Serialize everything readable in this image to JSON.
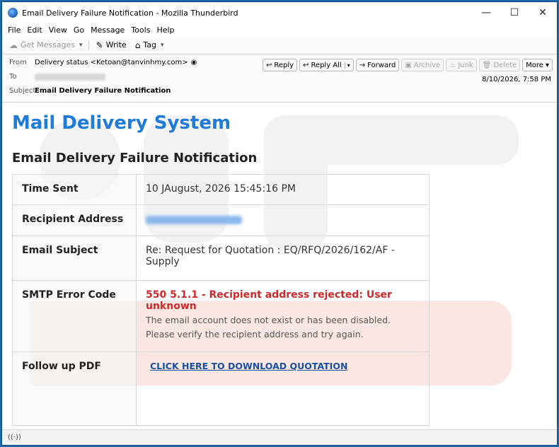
{
  "window": {
    "title": "Email Delivery Failure Notification - Mozilla Thunderbird",
    "controls": {
      "minimize": "—",
      "maximize": "☐",
      "close": "✕"
    }
  },
  "menu": {
    "items": [
      {
        "label": "File"
      },
      {
        "label": "Edit"
      },
      {
        "label": "View"
      },
      {
        "label": "Go"
      },
      {
        "label": "Message"
      },
      {
        "label": "Tools"
      },
      {
        "label": "Help"
      }
    ]
  },
  "toolbar": {
    "get_messages": "Get Messages",
    "write": "Write",
    "tag": "Tag"
  },
  "header": {
    "from_label": "From",
    "from_value": "Delivery status <Ketoan@tanvinhmy.com>",
    "to_label": "To",
    "subject_label": "Subject",
    "subject_value": "Email Delivery Failure Notification",
    "date": "8/10/2026, 7:58 PM",
    "actions": {
      "reply": "Reply",
      "reply_all": "Reply All",
      "forward": "Forward",
      "archive": "Archive",
      "junk": "Junk",
      "delete": "Delete",
      "more": "More"
    }
  },
  "message": {
    "heading": "Mail Delivery System",
    "subheading": "Email Delivery Failure Notification",
    "rows": {
      "time_sent_label": "Time Sent",
      "time_sent_value": "10 JAugust, 2026 15:45:16 PM",
      "recipient_label": "Recipient Address",
      "subject_label": "Email Subject",
      "subject_value": "Re: Request for Quotation : EQ/RFQ/2026/162/AF - Supply",
      "smtp_label": "SMTP Error Code",
      "smtp_code": "550 5.1.1 - Recipient address rejected: User unknown",
      "smtp_desc": "The email account does not exist or has been disabled. Please verify the recipient address and try again.",
      "followup_label": "Follow up PDF",
      "followup_link": "CLICK HERE TO DOWNLOAD QUOTATION"
    }
  },
  "colors": {
    "heading_blue": "#1e7bd8",
    "error_red": "#cc2a2a",
    "link_blue": "#1a4fa0",
    "window_border": "#0f4c81"
  },
  "icons": {
    "app": "thunderbird-icon",
    "get_messages": "cloud-download-icon",
    "write": "pencil-icon",
    "tag": "tag-icon",
    "reply": "reply-icon",
    "reply_all": "reply-all-icon",
    "forward": "forward-icon",
    "archive": "archive-icon",
    "junk": "junk-icon",
    "delete": "trash-icon",
    "status": "wifi-icon"
  }
}
